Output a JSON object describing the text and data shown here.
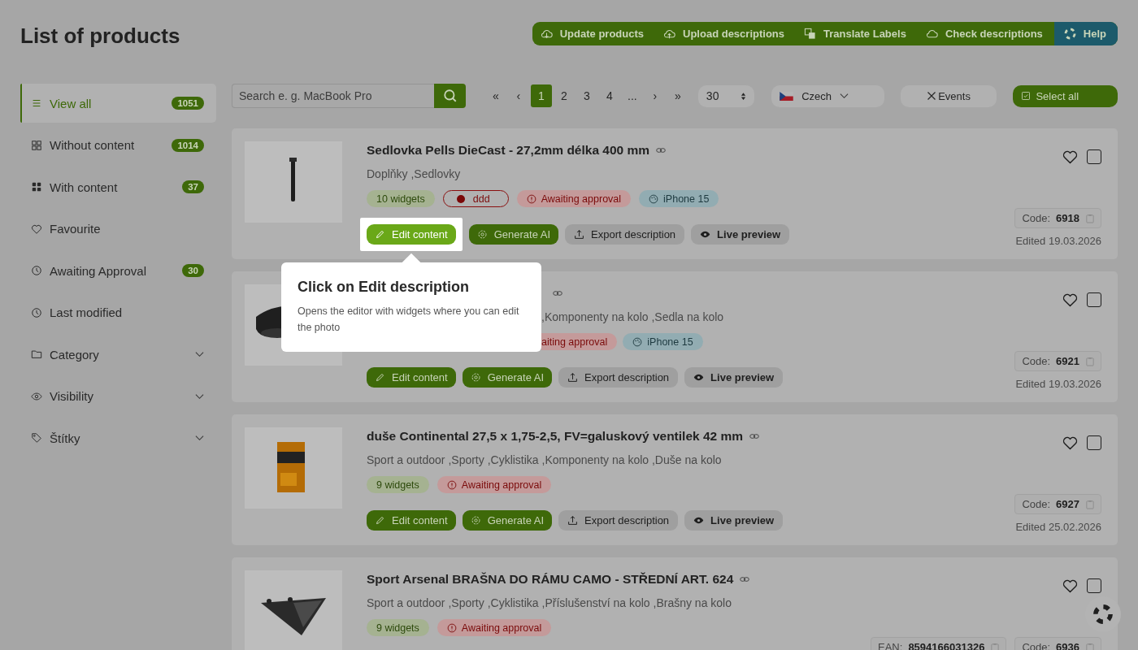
{
  "page_title": "List of products",
  "toolbar": {
    "actions": [
      {
        "kind": "cloud-down",
        "label": "Update products"
      },
      {
        "kind": "cloud-up",
        "label": "Upload descriptions"
      },
      {
        "kind": "translate",
        "label": "Translate Labels"
      },
      {
        "kind": "cloud-check",
        "label": "Check descriptions"
      }
    ],
    "help": "Help"
  },
  "sidebar": {
    "items": [
      {
        "kind": "list",
        "label": "View all",
        "count": "1051",
        "selected": true,
        "dropdown": false
      },
      {
        "kind": "grid-empty",
        "label": "Without content",
        "count": "1014",
        "selected": false,
        "dropdown": false
      },
      {
        "kind": "grid-full",
        "label": "With content",
        "count": "37",
        "selected": false,
        "dropdown": false
      },
      {
        "kind": "heart",
        "label": "Favourite",
        "selected": false,
        "dropdown": false
      },
      {
        "kind": "clock",
        "label": "Awaiting Approval",
        "count": "30",
        "selected": false,
        "dropdown": false
      },
      {
        "kind": "clock",
        "label": "Last modified",
        "selected": false,
        "dropdown": false
      },
      {
        "kind": "folder",
        "label": "Category",
        "selected": false,
        "dropdown": true
      },
      {
        "kind": "eye",
        "label": "Visibility",
        "selected": false,
        "dropdown": true
      },
      {
        "kind": "tag",
        "label": "Štítky",
        "selected": false,
        "dropdown": true
      }
    ]
  },
  "filters": {
    "search": {
      "placeholder": "Search e. g. MacBook Pro"
    },
    "pagination": {
      "first": "«",
      "prev": "‹",
      "pages": [
        {
          "label": "1",
          "selected": true
        },
        {
          "label": "2",
          "selected": false
        },
        {
          "label": "3",
          "selected": false
        },
        {
          "label": "4",
          "selected": false
        }
      ],
      "ellipsis": "...",
      "next": "›",
      "last": "»"
    },
    "per_page": "30",
    "language": "Czech",
    "events": "Events",
    "select_all": "Select all"
  },
  "products": [
    {
      "kind": "full",
      "checked": false,
      "title": "Sedlovka Pells DieCast - 27,2mm délka 400 mm",
      "categories": "Doplňky ,Sedlovky",
      "tags": [
        {
          "kind": "widgets",
          "label": "10 widgets"
        },
        {
          "kind": "label",
          "label": "ddd"
        },
        {
          "kind": "approval",
          "label": "Awaiting approval"
        },
        {
          "kind": "device",
          "label": "iPhone 15"
        }
      ],
      "buttons": [
        {
          "kind": "edit",
          "label": "Edit content",
          "spotlight": true
        },
        {
          "kind": "ai",
          "label": "Generate AI",
          "spotlight": false
        },
        {
          "kind": "export",
          "label": "Export description",
          "spotlight": false
        },
        {
          "kind": "preview",
          "label": "Live preview",
          "spotlight": false
        }
      ],
      "code_label": "Code:",
      "code": "6918",
      "edited": "Edited 19.03.2026"
    },
    {
      "kind": "partly-hidden",
      "checked": false,
      "categories": ",Komponenty na kolo ,Sedla na kolo",
      "tags": [
        {
          "kind": "approval",
          "label": "aiting approval"
        },
        {
          "kind": "device",
          "label": "iPhone 15"
        }
      ],
      "buttons": [
        {
          "kind": "edit",
          "label": "Edit content",
          "spotlight": false
        },
        {
          "kind": "ai",
          "label": "Generate AI",
          "spotlight": false
        },
        {
          "kind": "export",
          "label": "Export description",
          "spotlight": false
        },
        {
          "kind": "preview",
          "label": "Live preview",
          "spotlight": false
        }
      ],
      "code_label": "Code:",
      "code": "6921",
      "edited": "Edited 19.03.2026"
    },
    {
      "kind": "full",
      "checked": false,
      "title": "duše Continental 27,5 x 1,75-2,5, FV=galuskový ventilek 42 mm",
      "categories": "Sport a outdoor ,Sporty ,Cyklistika ,Komponenty na kolo ,Duše na kolo",
      "tags": [
        {
          "kind": "widgets",
          "label": "9 widgets"
        },
        {
          "kind": "approval",
          "label": "Awaiting approval"
        }
      ],
      "buttons": [
        {
          "kind": "edit",
          "label": "Edit content",
          "spotlight": false
        },
        {
          "kind": "ai",
          "label": "Generate AI",
          "spotlight": false
        },
        {
          "kind": "export",
          "label": "Export description",
          "spotlight": false
        },
        {
          "kind": "preview",
          "label": "Live preview",
          "spotlight": false
        }
      ],
      "code_label": "Code:",
      "code": "6927",
      "edited": "Edited 25.02.2026"
    },
    {
      "kind": "full",
      "checked": false,
      "title": "Sport Arsenal BRAŠNA DO RÁMU CAMO - STŘEDNÍ ART. 624",
      "categories": "Sport a outdoor ,Sporty ,Cyklistika ,Příslušenství na kolo ,Brašny na kolo",
      "tags": [
        {
          "kind": "widgets",
          "label": "9 widgets"
        },
        {
          "kind": "approval",
          "label": "Awaiting approval"
        }
      ],
      "ean_label": "EAN:",
      "ean": "8594166031326",
      "code_label": "Code:",
      "code": "6936"
    }
  ],
  "tour": {
    "title": "Click on Edit description",
    "text": "Opens the editor with widgets where you can edit the photo"
  }
}
